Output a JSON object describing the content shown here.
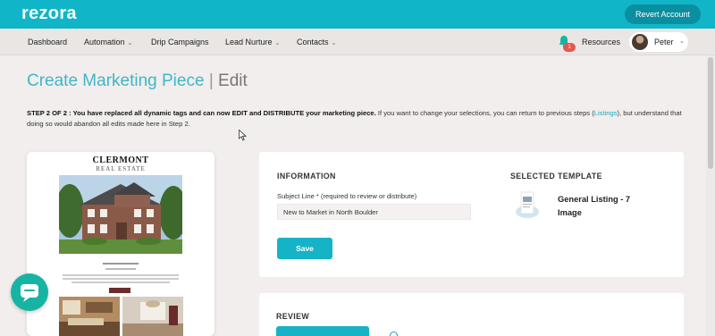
{
  "app": {
    "logo": "rezora",
    "revert_label": "Revert Account"
  },
  "nav": {
    "items": [
      {
        "label": "Dashboard",
        "has_menu": false
      },
      {
        "label": "Automation",
        "has_menu": true
      },
      {
        "label": "Drip Campaigns",
        "has_menu": false
      },
      {
        "label": "Lead Nurture",
        "has_menu": true
      },
      {
        "label": "Contacts",
        "has_menu": true
      }
    ],
    "notification_count": "1",
    "resources_label": "Resources",
    "user_name": "Peter"
  },
  "page": {
    "title_main": "Create Marketing Piece",
    "title_sep": "|",
    "title_edit": "Edit",
    "step_bold": "STEP 2 OF 2 : You have replaced all dynamic tags and can now EDIT and DISTRIBUTE your marketing piece.",
    "step_text_a": " If you want to change your selections, you can return to previous steps (",
    "step_link": "Listings",
    "step_text_b": "), but understand that doing so would abandon all edits made here in Step 2."
  },
  "preview": {
    "brand_line1": "CLERMONT",
    "brand_line2": "REAL ESTATE"
  },
  "information": {
    "heading": "INFORMATION",
    "subject_label": "Subject Line * (required to review or distribute)",
    "subject_value": "New to Market in North Boulder",
    "save_label": "Save"
  },
  "template": {
    "heading": "SELECTED TEMPLATE",
    "name": "General Listing - 7 Image"
  },
  "review": {
    "heading": "REVIEW"
  },
  "colors": {
    "brand_teal": "#10b5c8",
    "accent": "#16b3c6",
    "chat": "#18b4a3",
    "badge": "#e4574c"
  },
  "icons": [
    "bell-icon",
    "chevron-down-icon",
    "chat-icon",
    "info-icon",
    "cursor-icon"
  ]
}
